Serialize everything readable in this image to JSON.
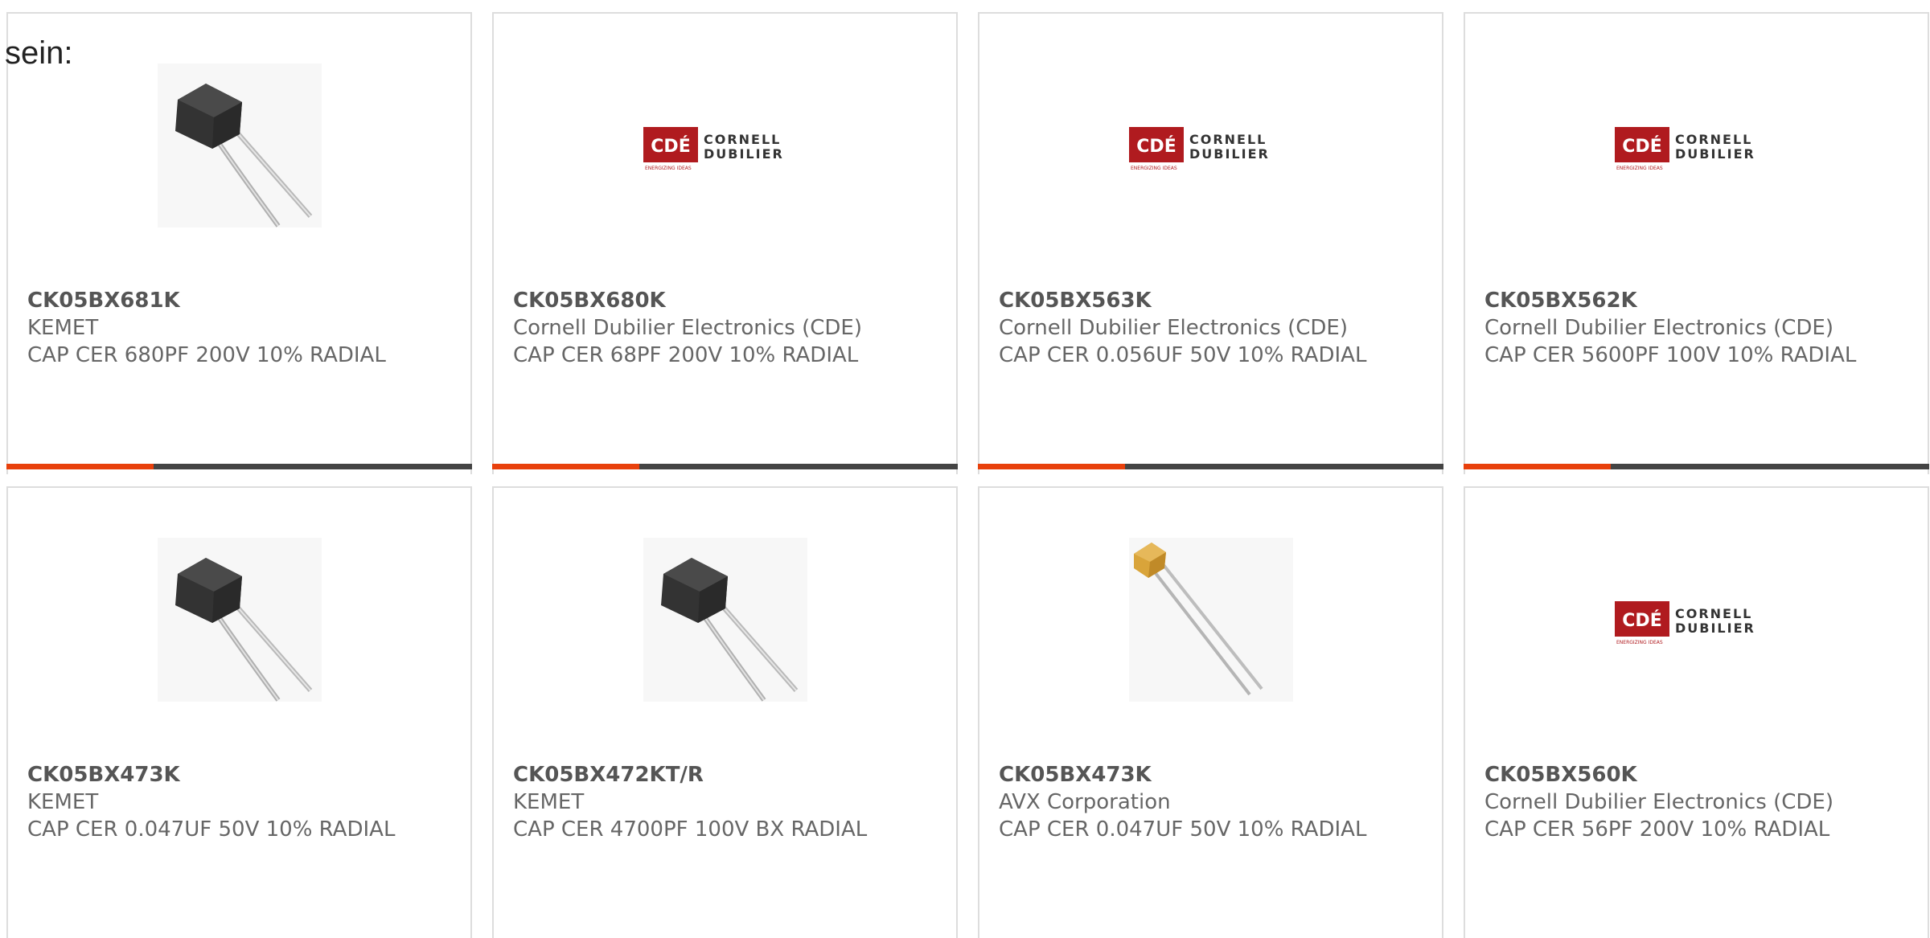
{
  "intro_text": "sein:",
  "colors": {
    "accent_bar": "#e8400c",
    "dark_bar": "#444444",
    "cde_red": "#b01b1f",
    "text": "#666666"
  },
  "products": [
    {
      "part_number": "CK05BX681K",
      "manufacturer": "KEMET",
      "description": "CAP CER 680PF 200V 10% RADIAL",
      "image": "black-radial-capacitor-image"
    },
    {
      "part_number": "CK05BX680K",
      "manufacturer": "Cornell Dubilier Electronics (CDE)",
      "description": "CAP CER 68PF 200V 10% RADIAL",
      "image": "cornell-dubilier-logo"
    },
    {
      "part_number": "CK05BX563K",
      "manufacturer": "Cornell Dubilier Electronics (CDE)",
      "description": "CAP CER 0.056UF 50V 10% RADIAL",
      "image": "cornell-dubilier-logo"
    },
    {
      "part_number": "CK05BX562K",
      "manufacturer": "Cornell Dubilier Electronics (CDE)",
      "description": "CAP CER 5600PF 100V 10% RADIAL",
      "image": "cornell-dubilier-logo"
    },
    {
      "part_number": "CK05BX473K",
      "manufacturer": "KEMET",
      "description": "CAP CER 0.047UF 50V 10% RADIAL",
      "image": "black-radial-capacitor-image"
    },
    {
      "part_number": "CK05BX472KT/R",
      "manufacturer": "KEMET",
      "description": "CAP CER 4700PF 100V BX RADIAL",
      "image": "black-radial-capacitor-image"
    },
    {
      "part_number": "CK05BX473K",
      "manufacturer": "AVX Corporation",
      "description": "CAP CER 0.047UF 50V 10% RADIAL",
      "image": "yellow-radial-capacitor-image"
    },
    {
      "part_number": "CK05BX560K",
      "manufacturer": "Cornell Dubilier Electronics (CDE)",
      "description": "CAP CER 56PF 200V 10% RADIAL",
      "image": "cornell-dubilier-logo"
    }
  ],
  "cde_logo": {
    "mark": "CDÉ",
    "line1": "CORNELL",
    "line2": "DUBILIER",
    "tagline": "ENERGIZING IDEAS"
  }
}
